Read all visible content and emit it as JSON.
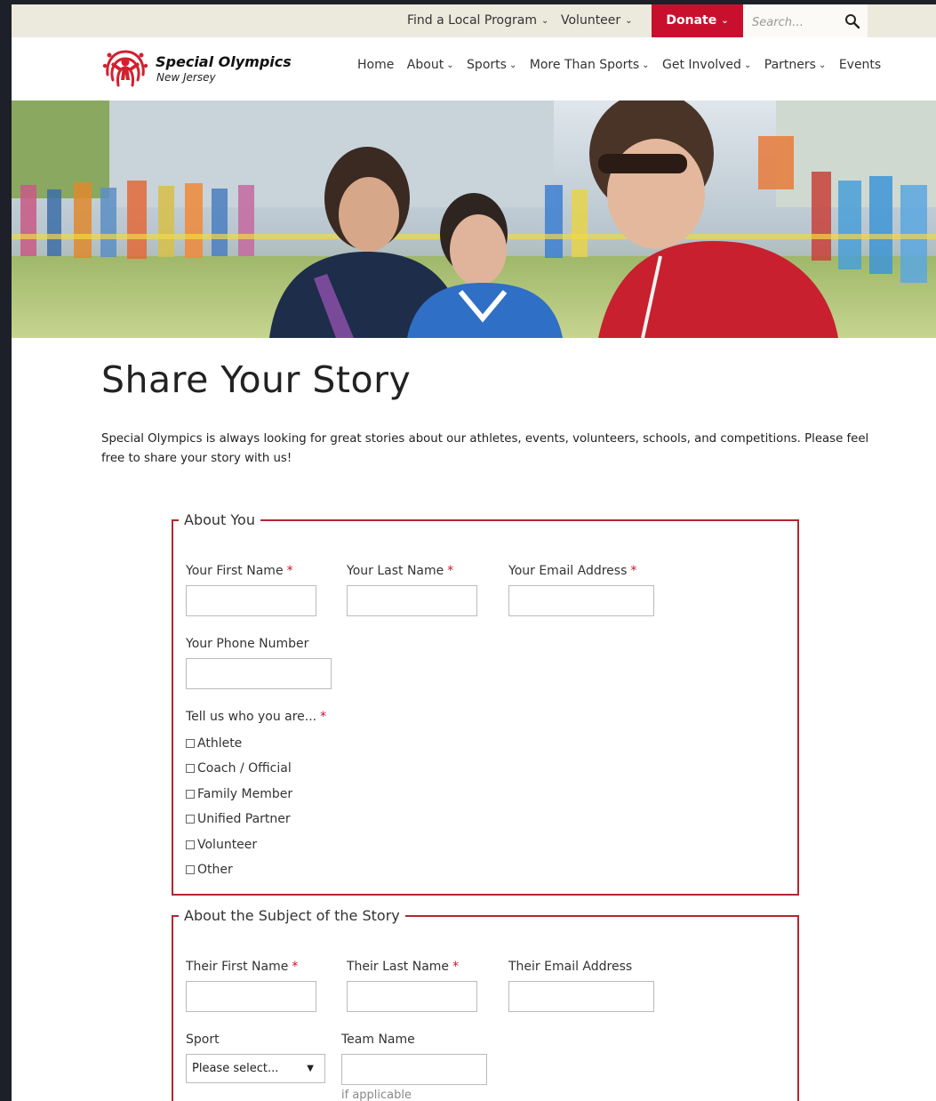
{
  "utility_bar": {
    "find_program": "Find a Local Program",
    "volunteer": "Volunteer",
    "donate": "Donate",
    "search_placeholder": "Search…"
  },
  "logo": {
    "title": "Special Olympics",
    "subtitle": "New Jersey"
  },
  "nav": {
    "items": [
      {
        "label": "Home",
        "dropdown": false
      },
      {
        "label": "About",
        "dropdown": true
      },
      {
        "label": "Sports",
        "dropdown": true
      },
      {
        "label": "More Than Sports",
        "dropdown": true
      },
      {
        "label": "Get Involved",
        "dropdown": true
      },
      {
        "label": "Partners",
        "dropdown": true
      },
      {
        "label": "Events",
        "dropdown": false
      }
    ],
    "chevron": "⌄"
  },
  "page": {
    "title": "Share Your Story",
    "intro": "Special Olympics is always looking for great stories about our athletes, events, volunteers, schools, and competitions.  Please feel free to share your story with us!"
  },
  "about_you": {
    "legend": "About You",
    "first_name_label": "Your First Name",
    "last_name_label": "Your Last Name",
    "email_label": "Your Email Address",
    "phone_label": "Your Phone Number",
    "who_label": "Tell us who you are...",
    "required_mark": "*",
    "roles": [
      "Athlete",
      "Coach / Official",
      "Family Member",
      "Unified Partner",
      "Volunteer",
      "Other"
    ]
  },
  "subject": {
    "legend": "About the Subject of the Story",
    "first_name_label": "Their First Name",
    "last_name_label": "Their Last Name",
    "email_label": "Their Email Address",
    "sport_label": "Sport",
    "sport_selected": "Please select...",
    "team_label": "Team Name",
    "team_hint": "if applicable",
    "required_mark": "*"
  },
  "colors": {
    "accent_red": "#c8102e",
    "border_red": "#b3272f",
    "utility_bg": "#ece9dd"
  }
}
